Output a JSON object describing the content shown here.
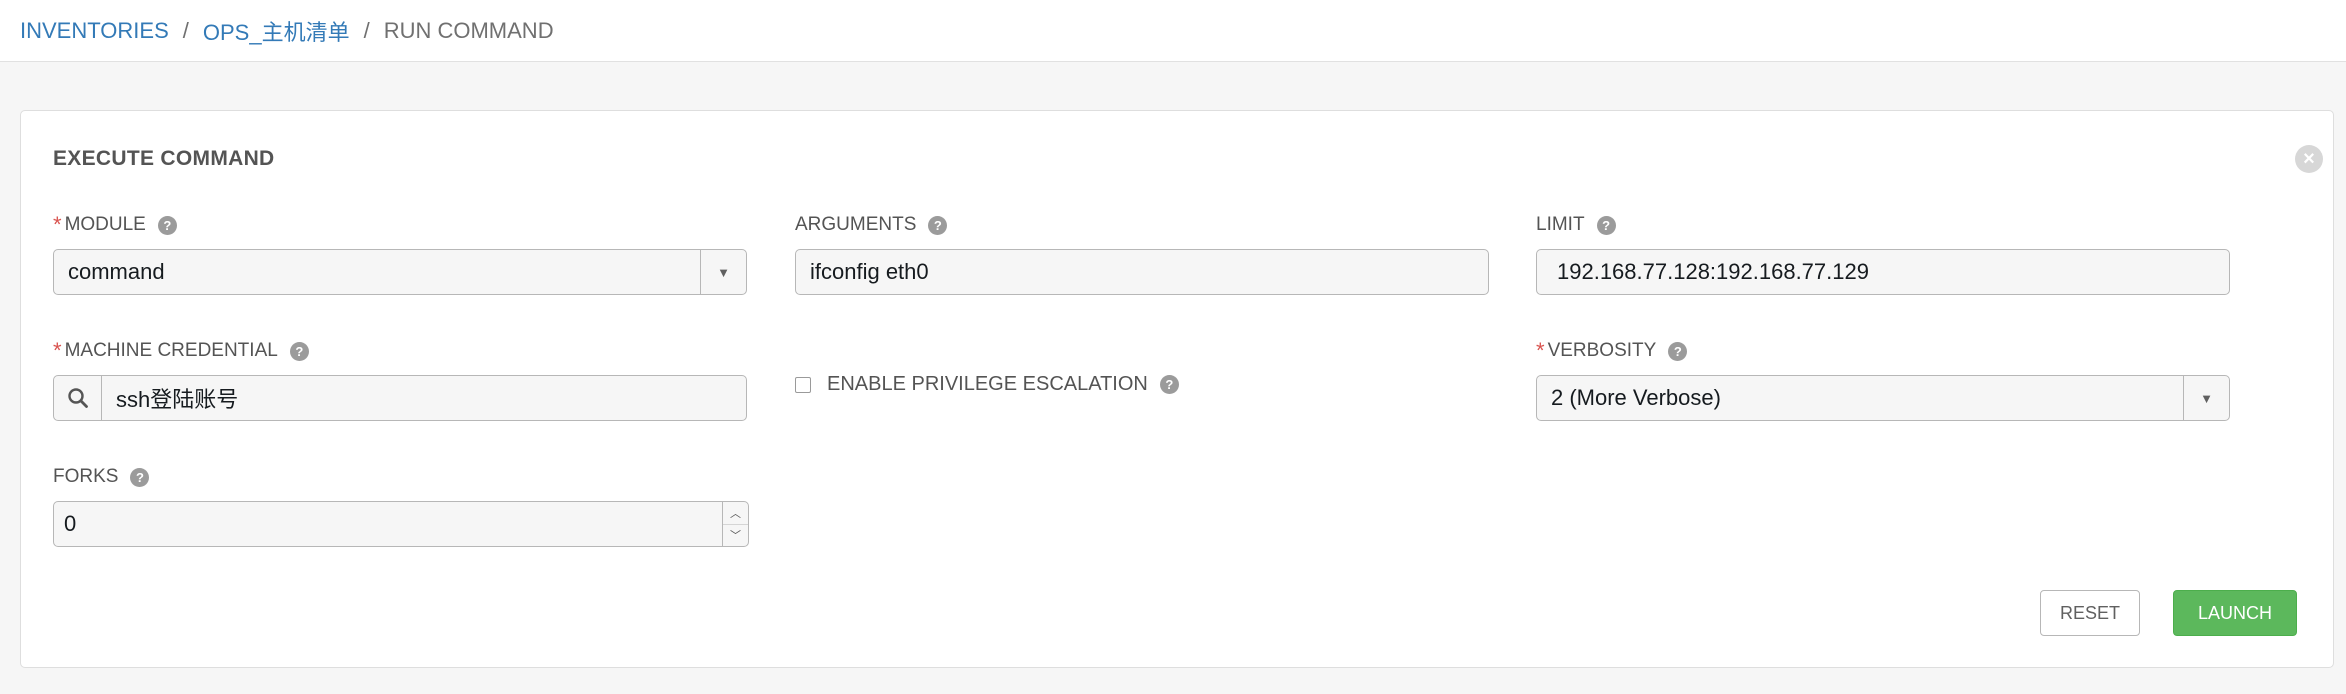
{
  "breadcrumb": {
    "items": [
      "INVENTORIES",
      "OPS_主机清单"
    ],
    "separator": "/",
    "current": "RUN COMMAND"
  },
  "panel": {
    "title": "EXECUTE COMMAND",
    "close_icon": "close-icon"
  },
  "fields": {
    "module": {
      "label": "MODULE",
      "required_mark": "*",
      "value": "command",
      "help": "?"
    },
    "arguments": {
      "label": "ARGUMENTS",
      "value": "ifconfig eth0",
      "help": "?"
    },
    "limit": {
      "label": "LIMIT",
      "value": "192.168.77.128:192.168.77.129",
      "help": "?"
    },
    "machine_credential": {
      "label": "MACHINE CREDENTIAL",
      "required_mark": "*",
      "value": "ssh登陆账号",
      "help": "?"
    },
    "privilege_escalation": {
      "label": "ENABLE PRIVILEGE ESCALATION",
      "checked": false,
      "help": "?"
    },
    "verbosity": {
      "label": "VERBOSITY",
      "required_mark": "*",
      "value": "2 (More Verbose)",
      "help": "?"
    },
    "forks": {
      "label": "FORKS",
      "value": "0",
      "help": "?"
    }
  },
  "actions": {
    "reset_label": "RESET",
    "launch_label": "LAUNCH"
  },
  "colors": {
    "link": "#337ab7",
    "required": "#d9534f",
    "launch": "#5cb85c"
  }
}
